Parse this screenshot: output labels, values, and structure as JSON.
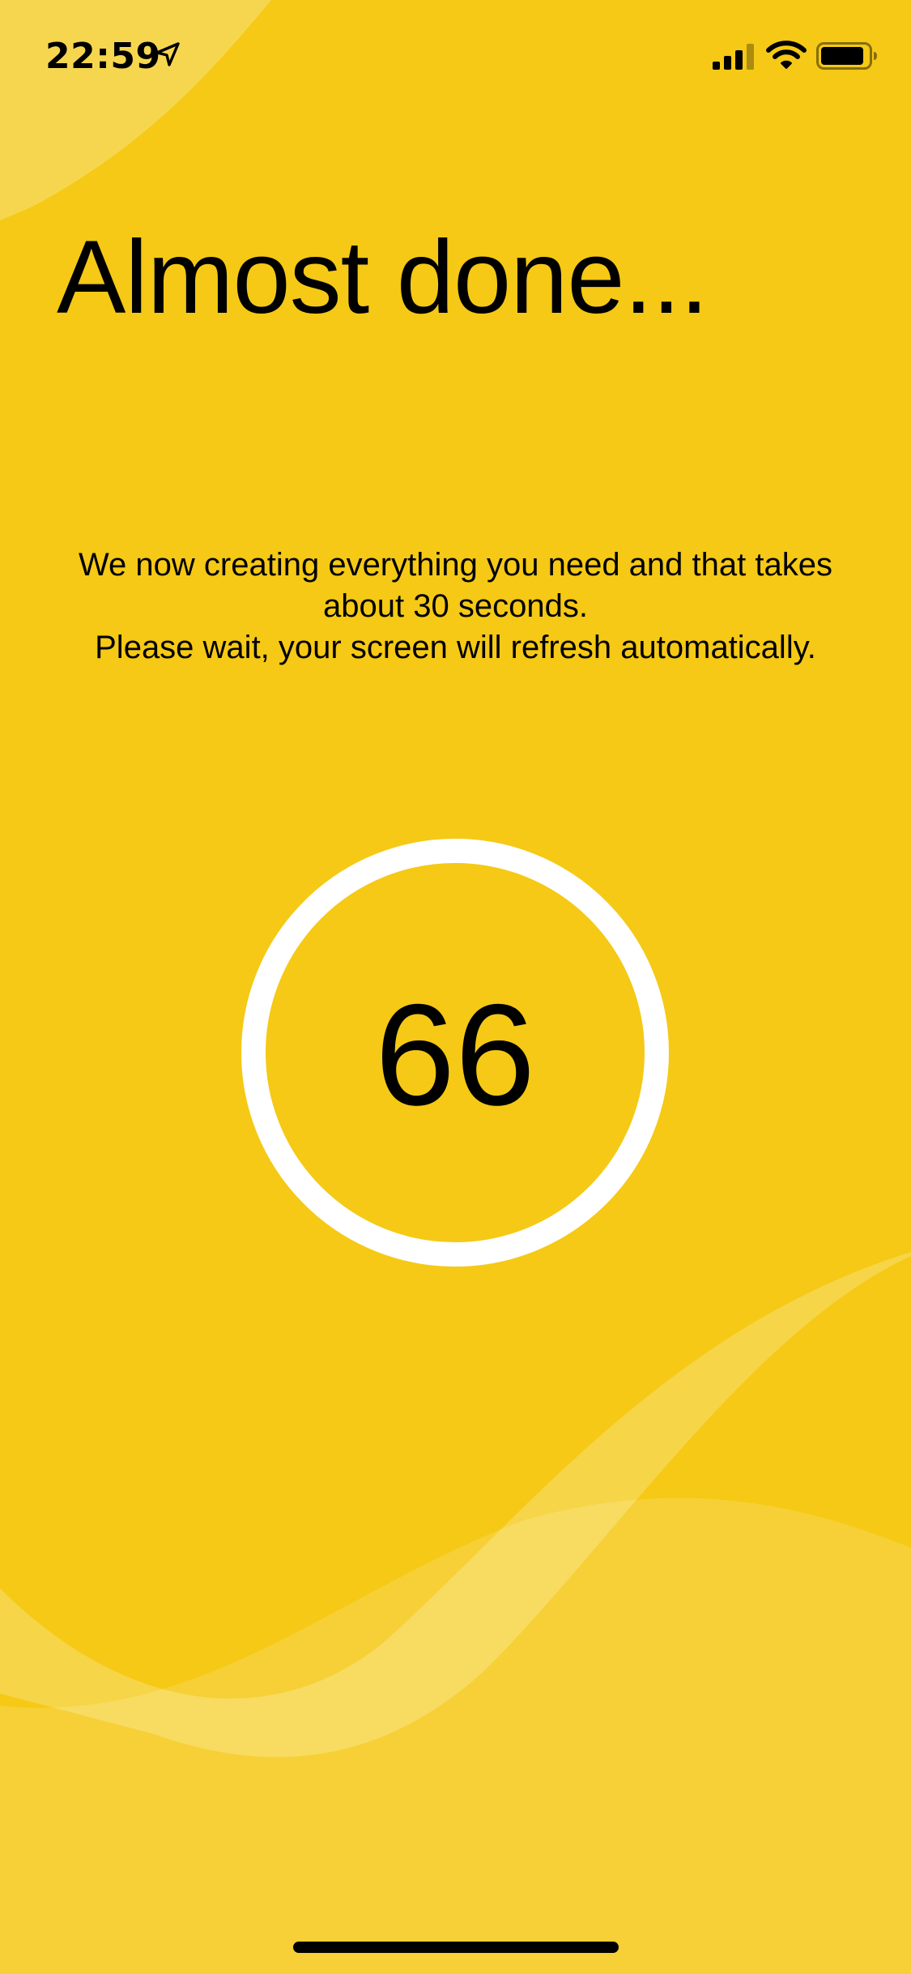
{
  "status_bar": {
    "time": "22:59",
    "icons": [
      "location-arrow-icon",
      "cellular-signal-icon",
      "wifi-icon",
      "battery-icon"
    ]
  },
  "title": "Almost done...",
  "message": {
    "line1": "We now creating everything you need and that takes about 30 seconds.",
    "line2": "Please wait, your screen will refresh automatically."
  },
  "countdown": {
    "value": "66"
  },
  "colors": {
    "background": "#F5C915",
    "wave_light": "#F7D96A",
    "ring": "#FFFFFF",
    "text": "#000000"
  }
}
